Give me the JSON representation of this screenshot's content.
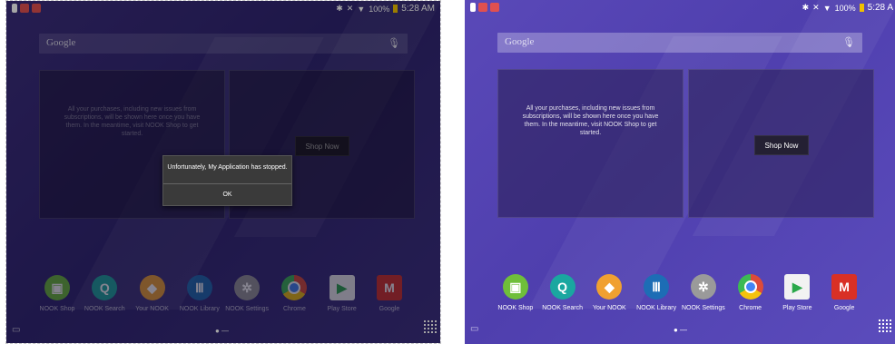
{
  "screens": [
    {
      "status_time": "5:28 AM",
      "status_battery": "100%",
      "search_label": "Google",
      "widget_text": "All your purchases, including new issues from subscriptions, will be shown here once you have them. In the meantime, visit NOOK Shop to get started.",
      "shop_button": "Shop Now",
      "dialog": {
        "message": "Unfortunately, My Application has stopped.",
        "ok": "OK"
      },
      "apps": [
        {
          "label": "NOOK Shop",
          "icon": "shopping-bag-icon",
          "color": "#6fbf3a"
        },
        {
          "label": "NOOK Search",
          "icon": "search-icon",
          "color": "#1aa7a0"
        },
        {
          "label": "Your NOOK",
          "icon": "your-nook-icon",
          "color": "#f0a030"
        },
        {
          "label": "NOOK Library",
          "icon": "library-icon",
          "color": "#1d6db5"
        },
        {
          "label": "NOOK Settings",
          "icon": "gear-icon",
          "color": "#9a9a9a"
        },
        {
          "label": "Chrome",
          "icon": "chrome-icon",
          "color": "#dd4b39"
        },
        {
          "label": "Play Store",
          "icon": "play-store-icon",
          "color": "#f2f2f2"
        },
        {
          "label": "Google",
          "icon": "gmail-icon",
          "color": "#d93025"
        }
      ]
    },
    {
      "status_time": "5:28 A",
      "status_battery": "100%",
      "search_label": "Google",
      "widget_text": "All your purchases, including new issues from subscriptions, will be shown here once you have them. In the meantime, visit NOOK Shop to get started.",
      "shop_button": "Shop Now",
      "apps": [
        {
          "label": "NOOK Shop",
          "icon": "shopping-bag-icon",
          "color": "#6fbf3a"
        },
        {
          "label": "NOOK Search",
          "icon": "search-icon",
          "color": "#1aa7a0"
        },
        {
          "label": "Your NOOK",
          "icon": "your-nook-icon",
          "color": "#f0a030"
        },
        {
          "label": "NOOK Library",
          "icon": "library-icon",
          "color": "#1d6db5"
        },
        {
          "label": "NOOK Settings",
          "icon": "gear-icon",
          "color": "#9a9a9a"
        },
        {
          "label": "Chrome",
          "icon": "chrome-icon",
          "color": "#dd4b39"
        },
        {
          "label": "Play Store",
          "icon": "play-store-icon",
          "color": "#f2f2f2"
        },
        {
          "label": "Google",
          "icon": "gmail-icon",
          "color": "#d93025"
        }
      ]
    }
  ]
}
